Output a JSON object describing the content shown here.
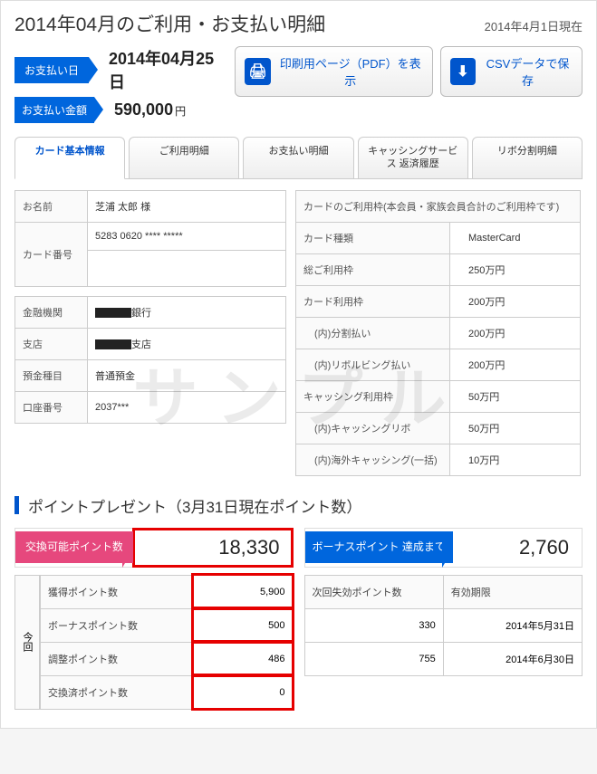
{
  "watermark": "サンプル",
  "header": {
    "title": "2014年04月のご利用・お支払い明細",
    "as_of": "2014年4月1日現在"
  },
  "payment": {
    "date_label": "お支払い日",
    "date_value": "2014年04月25日",
    "amount_label": "お支払い金額",
    "amount_value": "590,000",
    "yen": "円"
  },
  "actions": {
    "pdf": "印刷用ページ（PDF）を表示",
    "csv": "CSVデータで保存"
  },
  "tabs": {
    "t0": "カード基本情報",
    "t1": "ご利用明細",
    "t2": "お支払い明細",
    "t3": "キャッシングサービス\n返済履歴",
    "t4": "リボ分割明細"
  },
  "left_table": {
    "name_l": "お名前",
    "name_v": "芝浦 太郎 様",
    "card_l": "カード番号",
    "card_v": "5283 0620 **** *****",
    "bank_l": "金融機関",
    "bank_v": "銀行",
    "branch_l": "支店",
    "branch_v": "支店",
    "type_l": "預金種目",
    "type_v": "普通預金",
    "acct_l": "口座番号",
    "acct_v": "2037***"
  },
  "right_header": "カードのご利用枠(本会員・家族会員合計のご利用枠です)",
  "right_table": {
    "r0l": "カード種類",
    "r0v": "MasterCard",
    "r1l": "総ご利用枠",
    "r1v": "250万円",
    "r2l": "カード利用枠",
    "r2v": "200万円",
    "r3l": "(内)分割払い",
    "r3v": "200万円",
    "r4l": "(内)リボルビング払い",
    "r4v": "200万円",
    "r5l": "キャッシング利用枠",
    "r5v": "50万円",
    "r6l": "(内)キャッシングリボ",
    "r6v": "50万円",
    "r7l": "(内)海外キャッシング(一括)",
    "r7v": "10万円"
  },
  "points": {
    "section_title": "ポイントプレゼント（3月31日現在ポイント数）",
    "redeemable_label": "交換可能ポイント数",
    "redeemable_value": "18,330",
    "bonus_label": "ボーナスポイント\n達成まで",
    "bonus_value": "2,760",
    "side_label": "今回",
    "left_rows": {
      "r0l": "獲得ポイント数",
      "r0v": "5,900",
      "r1l": "ボーナスポイント数",
      "r1v": "500",
      "r2l": "調整ポイント数",
      "r2v": "486",
      "r3l": "交換済ポイント数",
      "r3v": "0"
    },
    "right_rows": {
      "h0": "次回失効ポイント数",
      "h1": "有効期限",
      "r0v0": "330",
      "r0v1": "2014年5月31日",
      "r1v0": "755",
      "r1v1": "2014年6月30日"
    }
  }
}
